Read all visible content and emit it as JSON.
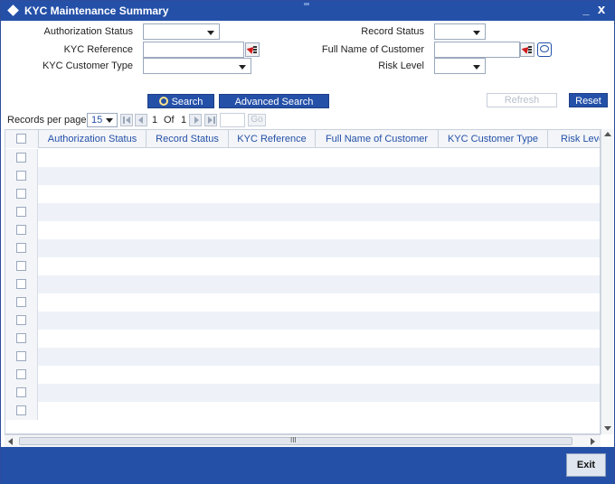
{
  "window": {
    "title": "KYC Maintenance Summary",
    "minimize": "_",
    "close": "x"
  },
  "form": {
    "authorization_status_label": "Authorization Status",
    "kyc_reference_label": "KYC Reference",
    "kyc_customer_type_label": "KYC Customer Type",
    "record_status_label": "Record Status",
    "full_name_label": "Full Name of Customer",
    "risk_level_label": "Risk Level"
  },
  "buttons": {
    "search": "Search",
    "advanced_search": "Advanced Search",
    "refresh": "Refresh",
    "reset": "Reset",
    "exit": "Exit"
  },
  "pager": {
    "records_per_page_label": "Records per page",
    "records_per_page_value": "15",
    "current_page": "1",
    "of_label": "Of",
    "total_pages": "1",
    "go_label": "Go"
  },
  "table": {
    "columns": [
      "Authorization Status",
      "Record Status",
      "KYC Reference",
      "Full Name of Customer",
      "KYC Customer Type",
      "Risk Level"
    ],
    "row_count": 15
  },
  "scrollbar": {
    "grip": "III"
  },
  "colors": {
    "primary": "#2450a8",
    "link_text": "#2450a8",
    "alt_row": "#eef2f8"
  }
}
